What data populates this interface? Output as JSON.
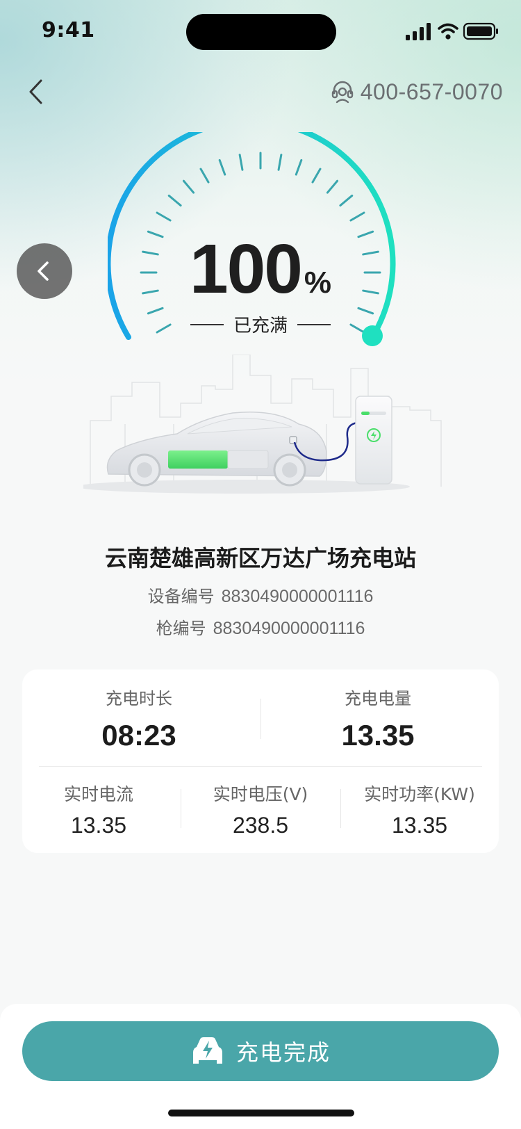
{
  "status_bar": {
    "time": "9:41"
  },
  "header": {
    "hotline": "400-657-0070"
  },
  "gauge": {
    "percent": "100",
    "percent_unit": "%",
    "status": "已充满",
    "level": 1.0,
    "arc_start": "#1aa3e8",
    "arc_end": "#1fe0c0"
  },
  "station": {
    "name": "云南楚雄高新区万达广场充电站",
    "device_label": "设备编号",
    "device_no": "8830490000001116",
    "gun_label": "枪编号",
    "gun_no": "8830490000001116"
  },
  "stats": {
    "duration_label": "充电时长",
    "duration": "08:23",
    "energy_label": "充电电量",
    "energy": "13.35",
    "current_label": "实时电流",
    "current": "13.35",
    "voltage_label": "实时电压(V)",
    "voltage": "238.5",
    "power_label": "实时功率(KW)",
    "power": "13.35"
  },
  "action": {
    "label": "充电完成"
  },
  "colors": {
    "accent": "#4aa6a9",
    "charge_green": "#4ade6a"
  }
}
